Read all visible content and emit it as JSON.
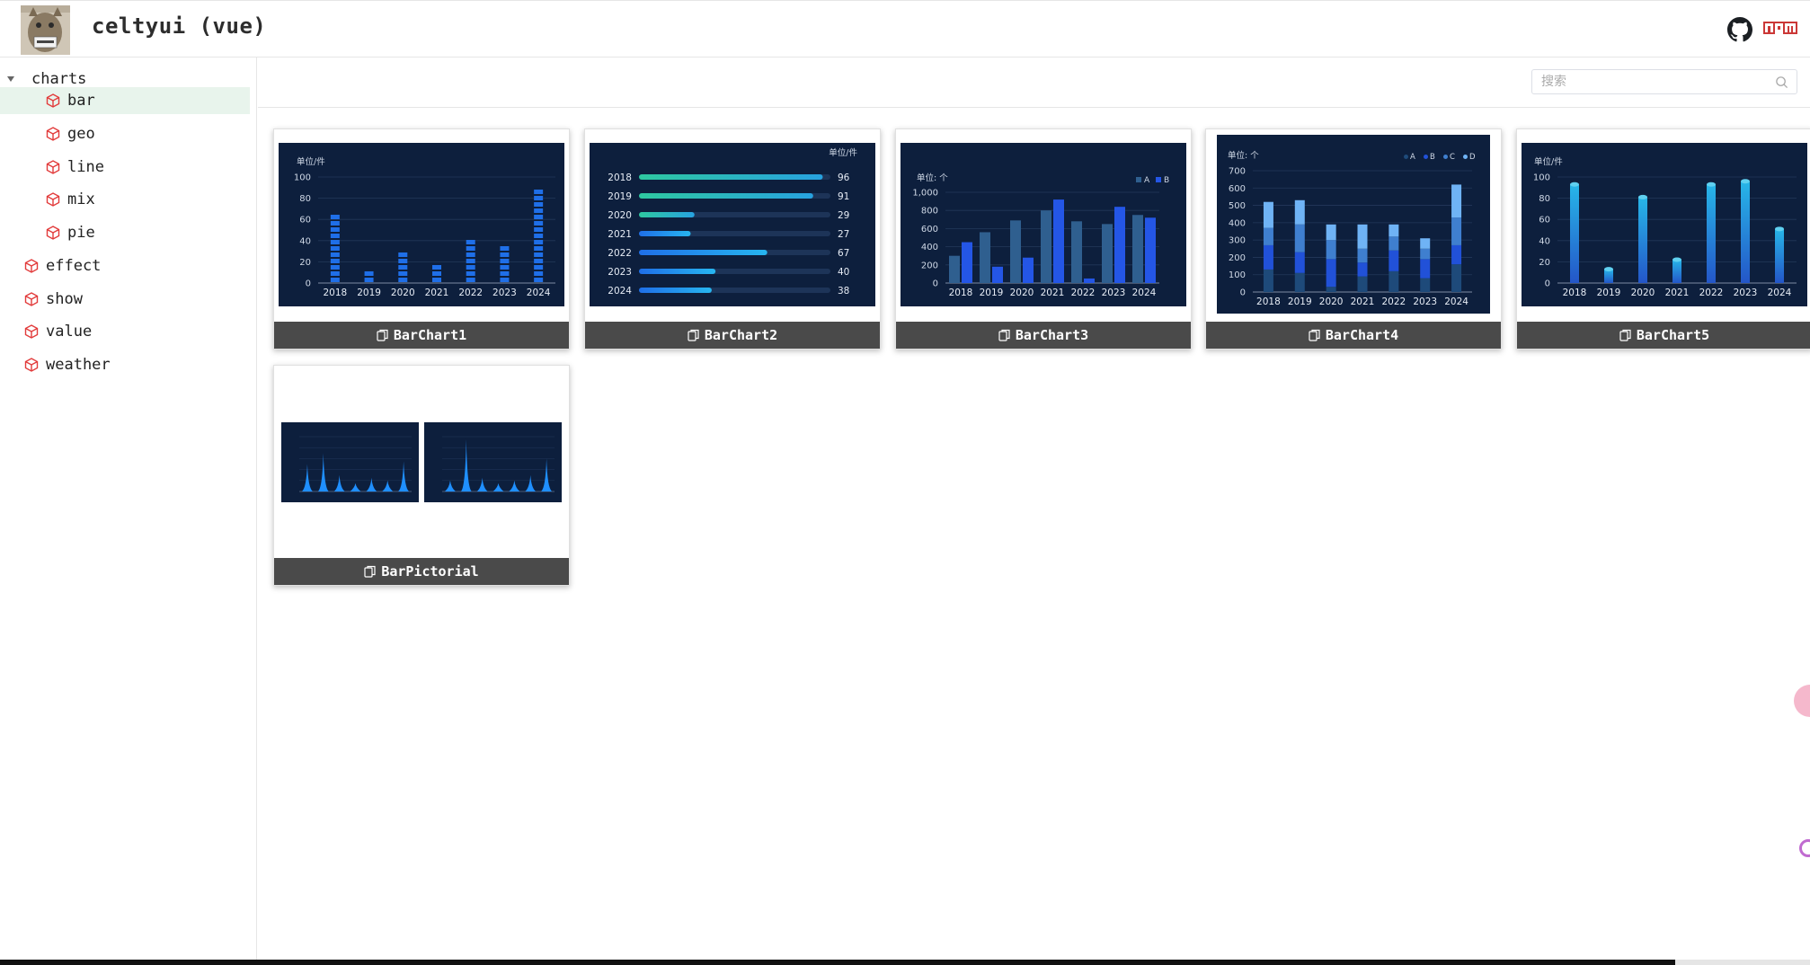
{
  "header": {
    "title": "celtyui (vue)",
    "github_icon": "github-icon",
    "npm_icon": "npm-icon"
  },
  "sidebar": {
    "items": [
      {
        "label": "charts",
        "expanded": true,
        "level": 0
      },
      {
        "label": "bar",
        "level": 1,
        "selected": true
      },
      {
        "label": "geo",
        "level": 1
      },
      {
        "label": "line",
        "level": 1
      },
      {
        "label": "mix",
        "level": 1
      },
      {
        "label": "pie",
        "level": 1
      },
      {
        "label": "effect",
        "level": 0
      },
      {
        "label": "show",
        "level": 0
      },
      {
        "label": "value",
        "level": 0
      },
      {
        "label": "weather",
        "level": 0
      }
    ]
  },
  "search": {
    "placeholder": "搜索",
    "value": ""
  },
  "cards": [
    {
      "name": "BarChart1"
    },
    {
      "name": "BarChart2"
    },
    {
      "name": "BarChart3"
    },
    {
      "name": "BarChart4"
    },
    {
      "name": "BarChart5"
    },
    {
      "name": "BarPictorial"
    }
  ],
  "chart_data": [
    {
      "type": "bar",
      "name_ref": "BarChart1",
      "unit_label": "单位/件",
      "categories": [
        "2018",
        "2019",
        "2020",
        "2021",
        "2022",
        "2023",
        "2024"
      ],
      "values": [
        65,
        13,
        34,
        21,
        44,
        38,
        92
      ],
      "yticks": [
        "0",
        "20",
        "40",
        "60",
        "80",
        "100"
      ],
      "ylim": [
        0,
        100
      ]
    },
    {
      "type": "bar",
      "name_ref": "BarChart2",
      "orientation": "horizontal",
      "unit_label": "单位/件",
      "categories": [
        "2018",
        "2019",
        "2020",
        "2021",
        "2022",
        "2023",
        "2024"
      ],
      "values": [
        96,
        91,
        29,
        27,
        67,
        40,
        38
      ],
      "value_labels": [
        "96",
        "91",
        "29",
        "27",
        "67",
        "40",
        "38"
      ],
      "xlim": [
        0,
        100
      ]
    },
    {
      "type": "bar",
      "name_ref": "BarChart3",
      "unit_label": "单位: 个",
      "categories": [
        "2018",
        "2019",
        "2020",
        "2021",
        "2022",
        "2023",
        "2024"
      ],
      "series": [
        {
          "name": "A",
          "values": [
            300,
            560,
            690,
            800,
            680,
            650,
            750
          ]
        },
        {
          "name": "B",
          "values": [
            450,
            180,
            280,
            920,
            50,
            840,
            720
          ]
        }
      ],
      "yticks": [
        "0",
        "200",
        "400",
        "600",
        "800",
        "1,000"
      ],
      "ylim": [
        0,
        1000
      ],
      "legend": "top-right"
    },
    {
      "type": "bar",
      "name_ref": "BarChart4",
      "stacked": true,
      "unit_label": "单位: 个",
      "categories": [
        "2018",
        "2019",
        "2020",
        "2021",
        "2022",
        "2023",
        "2024"
      ],
      "series": [
        {
          "name": "A",
          "values": [
            130,
            110,
            30,
            90,
            120,
            80,
            160
          ]
        },
        {
          "name": "B",
          "values": [
            140,
            120,
            160,
            80,
            120,
            110,
            110
          ]
        },
        {
          "name": "C",
          "values": [
            100,
            160,
            110,
            80,
            80,
            60,
            160
          ]
        },
        {
          "name": "D",
          "values": [
            150,
            140,
            90,
            140,
            70,
            60,
            190
          ]
        }
      ],
      "yticks": [
        "0",
        "100",
        "200",
        "300",
        "400",
        "500",
        "600",
        "700"
      ],
      "ylim": [
        0,
        700
      ],
      "legend": "top-right"
    },
    {
      "type": "bar",
      "name_ref": "BarChart5",
      "unit_label": "单位/件",
      "categories": [
        "2018",
        "2019",
        "2020",
        "2021",
        "2022",
        "2023",
        "2024"
      ],
      "values": [
        93,
        13,
        81,
        22,
        93,
        96,
        51
      ],
      "yticks": [
        "0",
        "20",
        "40",
        "60",
        "80",
        "100"
      ],
      "ylim": [
        0,
        100
      ]
    },
    {
      "type": "bar",
      "name_ref": "BarPictorial",
      "panels": [
        {
          "values": [
            50,
            70,
            30,
            15,
            25,
            20,
            55
          ]
        },
        {
          "values": [
            20,
            95,
            25,
            15,
            20,
            30,
            60
          ]
        }
      ]
    }
  ],
  "colors": {
    "chart_bg": "#0d1f3d",
    "bar_blue": "#1f6fe8",
    "bar_cyan": "#27a2e0",
    "bar_green": "#2ec8a0",
    "caption_bg": "#4a4a4a",
    "selected_bg": "#e8f4ec",
    "icon_red": "#e23b3b"
  }
}
